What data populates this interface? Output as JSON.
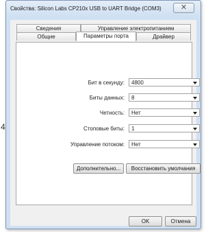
{
  "window": {
    "title": "Свойства: Silicon Labs CP210x USB to UART Bridge (COM3)",
    "close_glyph": "✕"
  },
  "tabs": {
    "row_back": [
      "Сведения",
      "Управление электропитанием"
    ],
    "row_front": [
      "Общие",
      "Параметры порта",
      "Драйвер"
    ],
    "active": "Параметры порта"
  },
  "port_settings": [
    {
      "label": "Бит в секунду:",
      "value": "4800"
    },
    {
      "label": "Биты данных:",
      "value": "8"
    },
    {
      "label": "Четность:",
      "value": "Нет"
    },
    {
      "label": "Стоповые биты:",
      "value": "1"
    },
    {
      "label": "Управление потоком:",
      "value": "Нет"
    }
  ],
  "buttons": {
    "advanced": "Дополнительно...",
    "restore_defaults": "Восстановить умолчания",
    "ok": "OK",
    "cancel": "Отмена"
  },
  "side_glyph": "4",
  "icons": {
    "close": "close-icon",
    "dropdown": "chevron-down-icon"
  }
}
